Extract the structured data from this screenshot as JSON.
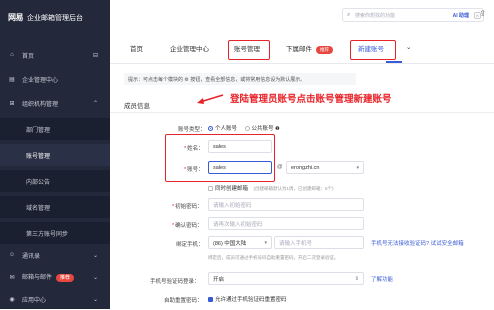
{
  "app": {
    "logo_mark": "网易",
    "title": "企业邮箱管理后台"
  },
  "sidebar": {
    "items": [
      {
        "label": "首页",
        "icon": "home-icon"
      },
      {
        "label": "企业管理中心",
        "icon": "building-icon"
      },
      {
        "label": "组织机构管理",
        "icon": "org-icon"
      },
      {
        "label": "部门管理"
      },
      {
        "label": "账号管理"
      },
      {
        "label": "内部公告"
      },
      {
        "label": "域名管理"
      },
      {
        "label": "第三方账号同步"
      },
      {
        "label": "通讯录",
        "icon": "contacts-icon"
      },
      {
        "label": "邮箱与邮件",
        "icon": "mail-icon",
        "badge": "推荐"
      },
      {
        "label": "应用中心",
        "icon": "apps-icon"
      }
    ]
  },
  "search": {
    "placeholder": "搜索你想找的功能",
    "ai_label": "AI 助理",
    "shortcut": "K"
  },
  "tabs": [
    {
      "label": "首页"
    },
    {
      "label": "企业管理中心"
    },
    {
      "label": "账号管理"
    },
    {
      "label": "下属邮件",
      "badge": "推荐"
    },
    {
      "label": "新建账号"
    },
    {
      "label": "⌄"
    }
  ],
  "tip": "提示：可点击每个模块的 ⚙ 按钮，查看全部信息，或将常用信息设为默认展示。",
  "annotation": "登陆管理员账号点击账号管理新建账号",
  "section_title": "成员信息",
  "form": {
    "account_type_label": "账号类型：",
    "account_type_personal": "个人账号",
    "account_type_public": "公共账号",
    "name_label": "姓名：",
    "name_value": "sales",
    "account_label": "账号：",
    "account_value": "sales",
    "domain_at": "@",
    "domain_value": "erongzhi.cn",
    "sync_create_label": "同时创建邮箱",
    "sync_create_hint": "(创建邮箱默认为1周，已创建邮箱：5个)",
    "init_pwd_label": "初始密码：",
    "init_pwd_placeholder": "请输入初始密码",
    "confirm_pwd_label": "确认密码：",
    "confirm_pwd_placeholder": "请再次输入初始密码",
    "phone_label": "绑定手机：",
    "phone_country": "(86) 中国大陆",
    "phone_placeholder": "请输入手机号",
    "phone_link": "手机号无法接收验证码? 试试安全邮箱",
    "phone_hint": "绑定后，成员可通过手机号码自助重置密码，开启二次登录验证。",
    "verify_login_label": "手机号验证码登录：",
    "verify_login_value": "开启",
    "learn_more": "了解功能",
    "self_reset_label": "自助重置密码：",
    "self_reset_value": "允许通过手机验证码重置密码"
  },
  "colors": {
    "accent": "#3a5bd6",
    "highlight": "#e8242b",
    "sidebar_bg": "#23283a"
  }
}
